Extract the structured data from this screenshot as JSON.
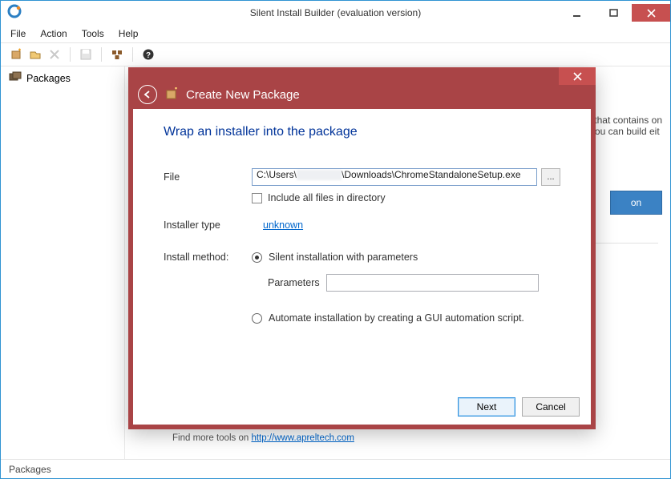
{
  "window": {
    "title": "Silent Install Builder (evaluation version)"
  },
  "menubar": {
    "file": "File",
    "action": "Action",
    "tools": "Tools",
    "help": "Help"
  },
  "sidebar": {
    "packages_label": "Packages"
  },
  "background": {
    "line1": "ge that contains on",
    "line2": "). You can build eit",
    "button": "on",
    "footer_prefix": "Find more tools on ",
    "footer_link": "http://www.apreltech.com"
  },
  "statusbar": {
    "left": "Packages"
  },
  "dialog": {
    "title": "Create New Package",
    "heading": "Wrap an installer into the package",
    "file_label": "File",
    "file_prefix": "C:\\Users\\",
    "file_suffix": "\\Downloads\\ChromeStandaloneSetup.exe",
    "include_label": "Include all files in directory",
    "installer_type_label": "Installer type",
    "installer_type_value": "unknown",
    "install_method_label": "Install method:",
    "method_silent": "Silent installation with parameters",
    "parameters_label": "Parameters",
    "method_automate": "Automate installation by creating a GUI automation script.",
    "next": "Next",
    "cancel": "Cancel",
    "browse": "..."
  }
}
